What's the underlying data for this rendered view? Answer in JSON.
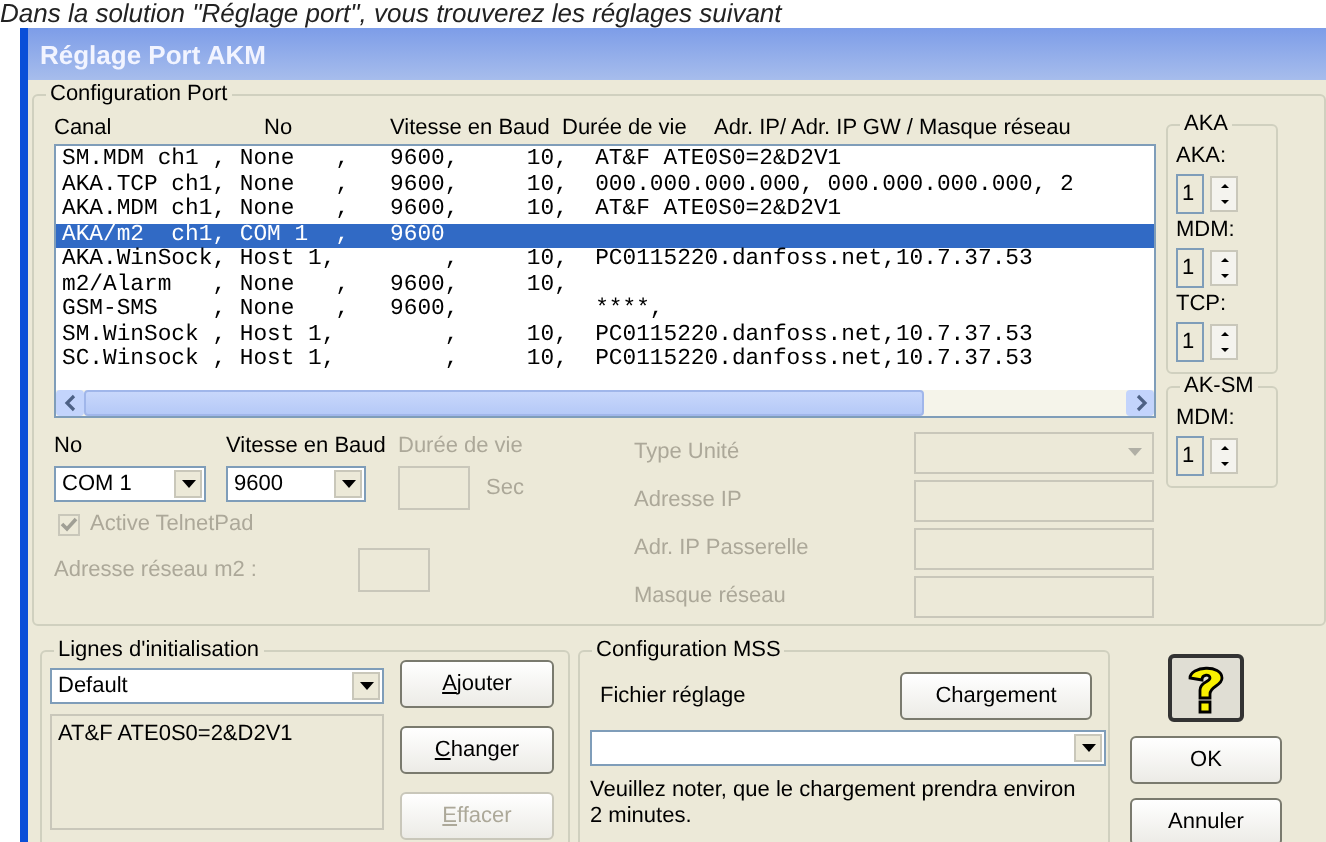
{
  "caption": "Dans la solution \"Réglage port\", vous trouverez les réglages suivant",
  "window": {
    "title": "Réglage Port AKM"
  },
  "port_config": {
    "title": "Configuration Port",
    "columns": [
      "Canal",
      "No",
      "Vitesse en Baud",
      "Durée de vie",
      "Adr. IP/ Adr. IP GW / Masque réseau"
    ],
    "rows": [
      {
        "text": "SM.MDM ch1 , None   ,   9600,     10,  AT&F ATE0S0=2&D2V1",
        "selected": false
      },
      {
        "text": "AKA.TCP ch1, None   ,   9600,     10,  000.000.000.000, 000.000.000.000, 2",
        "selected": false
      },
      {
        "text": "AKA.MDM ch1, None   ,   9600,     10,  AT&F ATE0S0=2&D2V1",
        "selected": false
      },
      {
        "text": "AKA/m2  ch1, COM 1  ,   9600",
        "selected": true
      },
      {
        "text": "AKA.WinSock, Host 1,        ,     10,  PC0115220.danfoss.net,10.7.37.53",
        "selected": false
      },
      {
        "text": "m2/Alarm   , None   ,   9600,     10,",
        "selected": false
      },
      {
        "text": "GSM-SMS    , None   ,   9600,          ****,",
        "selected": false
      },
      {
        "text": "SM.WinSock , Host 1,        ,     10,  PC0115220.danfoss.net,10.7.37.53",
        "selected": false
      },
      {
        "text": "SC.Winsock , Host 1,        ,     10,  PC0115220.danfoss.net,10.7.37.53",
        "selected": false
      }
    ]
  },
  "aka_group": {
    "title": "AKA",
    "spinners": [
      {
        "label": "AKA:",
        "value": "1"
      },
      {
        "label": "MDM:",
        "value": "1"
      },
      {
        "label": "TCP:",
        "value": "1"
      }
    ]
  },
  "aksm_group": {
    "title": "AK-SM",
    "spinners": [
      {
        "label": "MDM:",
        "value": "1"
      }
    ]
  },
  "port_fields": {
    "no": {
      "label": "No",
      "value": "COM 1"
    },
    "baud": {
      "label": "Vitesse en Baud",
      "value": "9600"
    },
    "lifetime": {
      "label": "Durée de vie",
      "unit": "Sec",
      "disabled": true
    },
    "telnet": {
      "label": "Active TelnetPad",
      "checked": true,
      "disabled": true
    },
    "m2_address": {
      "label": "Adresse réseau m2 :",
      "disabled": true
    }
  },
  "unit_fields": [
    {
      "label": "Type Unité",
      "kind": "dropdown",
      "disabled": true
    },
    {
      "label": "Adresse IP",
      "kind": "text",
      "disabled": true
    },
    {
      "label": "Adr. IP Passerelle",
      "kind": "text",
      "disabled": true
    },
    {
      "label": "Masque réseau",
      "kind": "text",
      "disabled": true
    }
  ],
  "init_lines": {
    "title": "Lignes d'initialisation",
    "selector": "Default",
    "text": "AT&F ATE0S0=2&D2V1",
    "buttons": [
      {
        "label": "Ajouter",
        "disabled": false
      },
      {
        "label": "Changer",
        "disabled": false
      },
      {
        "label": "Effacer",
        "disabled": true
      }
    ]
  },
  "mss": {
    "title": "Configuration MSS",
    "file_label": "Fichier réglage",
    "load_button": "Chargement",
    "note": "Veuillez noter, que le chargement prendra environ 2 minutes."
  },
  "dialog_buttons": [
    "OK",
    "Annuler"
  ]
}
